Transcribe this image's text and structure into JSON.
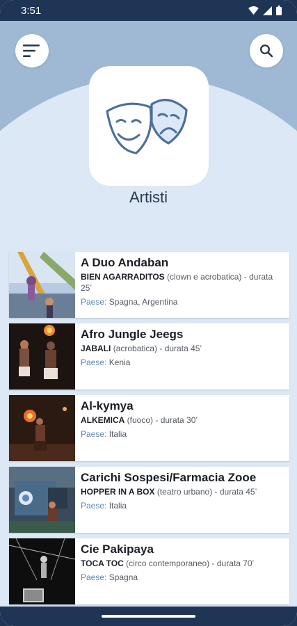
{
  "status": {
    "time": "3:51"
  },
  "header": {
    "title": "Artisti"
  },
  "icons": {
    "menu": "sort-menu-icon",
    "search": "search-icon",
    "app": "theater-masks-icon"
  },
  "labels": {
    "country": "Paese:"
  },
  "artists": [
    {
      "name": "A Duo Andaban",
      "show": "BIEN AGARRADITOS",
      "genre": "(clown e acrobatica)",
      "duration": " - durata 25’",
      "country": "Spagna, Argentina"
    },
    {
      "name": "Afro Jungle Jeegs",
      "show": "JABALI",
      "genre": "(acrobatica)",
      "duration": " - durata 45’",
      "country": "Kenia"
    },
    {
      "name": "Al-kymya",
      "show": "ALKEMICA",
      "genre": "(fuoco)",
      "duration": " - durata 30’",
      "country": "Italia"
    },
    {
      "name": "Carichi Sospesi/Farmacia Zooe",
      "show": "HOPPER IN A BOX",
      "genre": "(teatro urbano)",
      "duration": " - durata 45’",
      "country": "Italia"
    },
    {
      "name": "Cie Pakipaya",
      "show": "TOCA TOC",
      "genre": "(circo contemporaneo)",
      "duration": " - durata 70’",
      "country": "Spagna"
    }
  ],
  "colors": {
    "statusbar": "#1f3556",
    "header": "#9fb9d5",
    "arc": "#dce8f5",
    "accent": "#5d86b5",
    "icon": "#4b6f9c"
  }
}
